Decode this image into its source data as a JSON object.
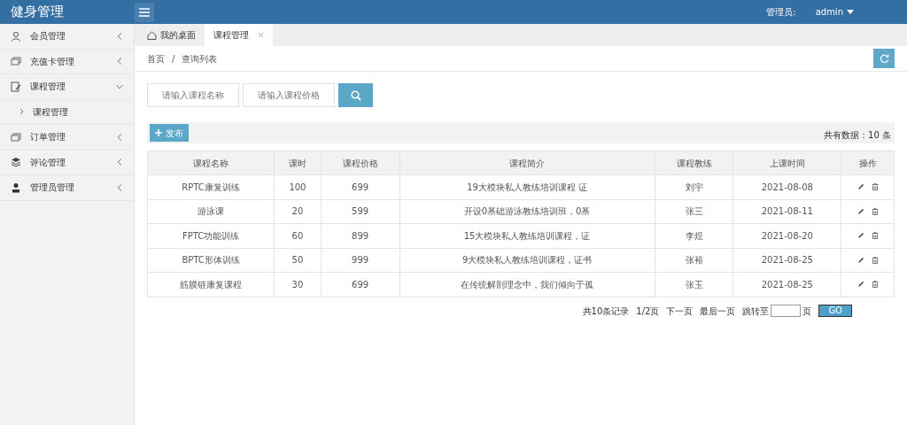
{
  "header": {
    "title": "健身管理",
    "user_label": "管理员:",
    "user_name": "admin"
  },
  "sidebar": {
    "items": [
      {
        "label": "会员管理",
        "kind": "person",
        "expanded": false
      },
      {
        "label": "充值卡管理",
        "kind": "card",
        "expanded": false
      },
      {
        "label": "课程管理",
        "kind": "edit",
        "expanded": true,
        "children": [
          {
            "label": "课程管理"
          }
        ]
      },
      {
        "label": "订单管理",
        "kind": "card",
        "expanded": false
      },
      {
        "label": "评论管理",
        "kind": "layers",
        "expanded": false
      },
      {
        "label": "管理员管理",
        "kind": "user",
        "expanded": false
      }
    ]
  },
  "tabs": [
    {
      "label": "我的桌面",
      "kind": "home",
      "selected": false
    },
    {
      "label": "课程管理",
      "kind": "closable",
      "selected": true
    }
  ],
  "breadcrumb": [
    "首页",
    "/",
    "查询列表"
  ],
  "search": {
    "fields": [
      {
        "placeholder": "请输入课程名称"
      },
      {
        "placeholder": "请输入课程价格"
      }
    ]
  },
  "toolbar": {
    "add_button": "发布",
    "total": "共有数据：10 条"
  },
  "table": {
    "columns": [
      "课程名称",
      "课时",
      "课程价格",
      "课程简介",
      "课程教练",
      "上课时间",
      "操作"
    ],
    "rows": [
      [
        "RPTC康复训练",
        "100",
        "699",
        "19大模块私人教练培训课程 证",
        "刘宇",
        "2021-08-08"
      ],
      [
        "游泳课",
        "20",
        "599",
        "开设0基础游泳教练培训班，0基",
        "张三",
        "2021-08-11"
      ],
      [
        "FPTC功能训练",
        "60",
        "899",
        "15大模块私人教练培训课程，证",
        "李煜",
        "2021-08-20"
      ],
      [
        "BPTC形体训练",
        "50",
        "999",
        "9大模块私人教练培训课程，证书",
        "张裕",
        "2021-08-25"
      ],
      [
        "筋膜链康复课程",
        "30",
        "699",
        "在传统解剖理念中，我们倾向于孤",
        "张玉",
        "2021-08-25"
      ]
    ]
  },
  "pagination": {
    "summary": "共10条记录",
    "page": "1/2页",
    "next": "下一页",
    "last": "最后一页",
    "jump_label": "跳转至",
    "page_unit": "页",
    "go": "GO"
  }
}
